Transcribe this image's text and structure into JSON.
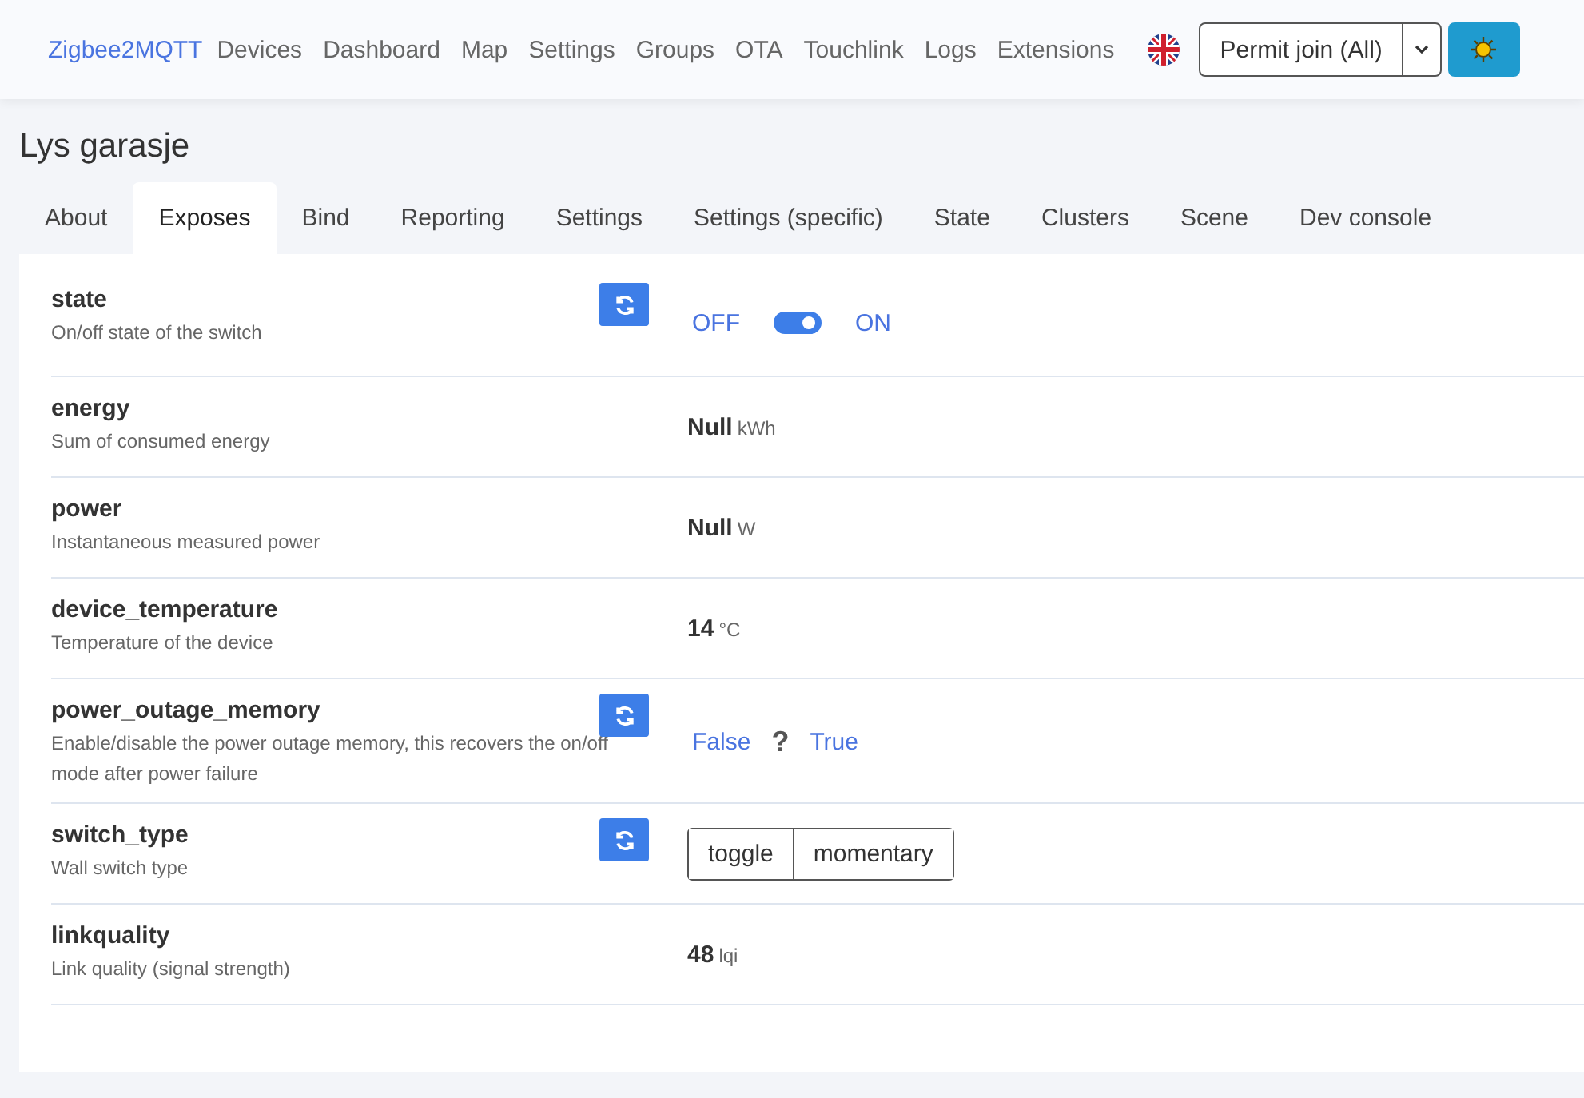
{
  "navbar": {
    "brand": "Zigbee2MQTT",
    "links": [
      "Devices",
      "Dashboard",
      "Map",
      "Settings",
      "Groups",
      "OTA",
      "Touchlink",
      "Logs",
      "Extensions"
    ],
    "permit_join": "Permit join (All)"
  },
  "device": {
    "title": "Lys garasje"
  },
  "tabs": [
    {
      "label": "About",
      "selected": false
    },
    {
      "label": "Exposes",
      "selected": true
    },
    {
      "label": "Bind",
      "selected": false
    },
    {
      "label": "Reporting",
      "selected": false
    },
    {
      "label": "Settings",
      "selected": false
    },
    {
      "label": "Settings (specific)",
      "selected": false
    },
    {
      "label": "State",
      "selected": false
    },
    {
      "label": "Clusters",
      "selected": false
    },
    {
      "label": "Scene",
      "selected": false
    },
    {
      "label": "Dev console",
      "selected": false
    }
  ],
  "exposes": [
    {
      "kind": "switch",
      "name": "state",
      "description": "On/off state of the switch",
      "refresh": true,
      "off_label": "OFF",
      "on_label": "ON",
      "on": true
    },
    {
      "kind": "value",
      "name": "energy",
      "description": "Sum of consumed energy",
      "refresh": false,
      "value": "Null",
      "unit": "kWh"
    },
    {
      "kind": "value",
      "name": "power",
      "description": "Instantaneous measured power",
      "refresh": false,
      "value": "Null",
      "unit": "W"
    },
    {
      "kind": "value",
      "name": "device_temperature",
      "description": "Temperature of the device",
      "refresh": false,
      "value": "14",
      "unit": "°C"
    },
    {
      "kind": "binary",
      "name": "power_outage_memory",
      "description": "Enable/disable the power outage memory, this recovers the on/off mode after power failure",
      "refresh": true,
      "off_label": "False",
      "unknown_mark": "?",
      "on_label": "True"
    },
    {
      "kind": "enum",
      "name": "switch_type",
      "description": "Wall switch type",
      "refresh": true,
      "options": [
        "toggle",
        "momentary"
      ]
    },
    {
      "kind": "value",
      "name": "linkquality",
      "description": "Link quality (signal strength)",
      "refresh": false,
      "value": "48",
      "unit": "lqi"
    }
  ]
}
